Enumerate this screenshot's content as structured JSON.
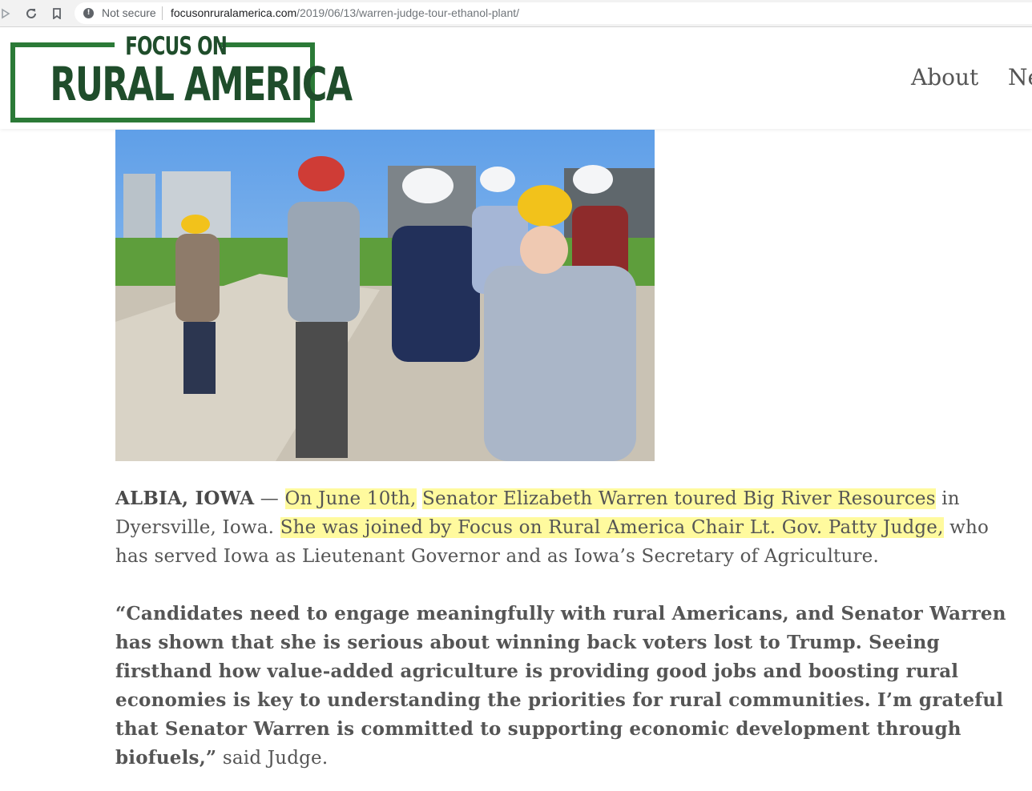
{
  "browser": {
    "security_label": "Not secure",
    "url_host": "focusonruralamerica.com",
    "url_path": "/2019/06/13/warren-judge-tour-ethanol-plant/"
  },
  "site": {
    "logo_top": "FOCUS ON",
    "logo_main": "RURAL AMERICA",
    "nav": [
      "About",
      "Ne"
    ],
    "brand_color": "#2b7a37"
  },
  "article": {
    "dateline": "ALBIA, IOWA",
    "dash": " — ",
    "p1_hl1": "On June 10th,",
    "p1_hl2": "Senator Elizabeth Warren toured Big River Resources",
    "p1_mid": " in Dyersville, Iowa. ",
    "p1_hl3": "She was joined by Focus on Rural America Chair Lt. Gov. Patty Judge,",
    "p1_end": " who has served Iowa as Lieutenant Governor and as Iowa’s Secretary of Agriculture.",
    "quote": "“Candidates need to engage meaningfully with rural Americans, and Senator Warren has shown that she is serious about winning back voters lost to Trump. Seeing firsthand how value-added agriculture is providing good jobs and boosting rural economies is key to understanding the priorities for rural communities. I’m grateful that Senator Warren is committed to supporting economic development through biofuels,”",
    "attribution": " said Judge.",
    "highlight_color": "#fffa9e"
  }
}
